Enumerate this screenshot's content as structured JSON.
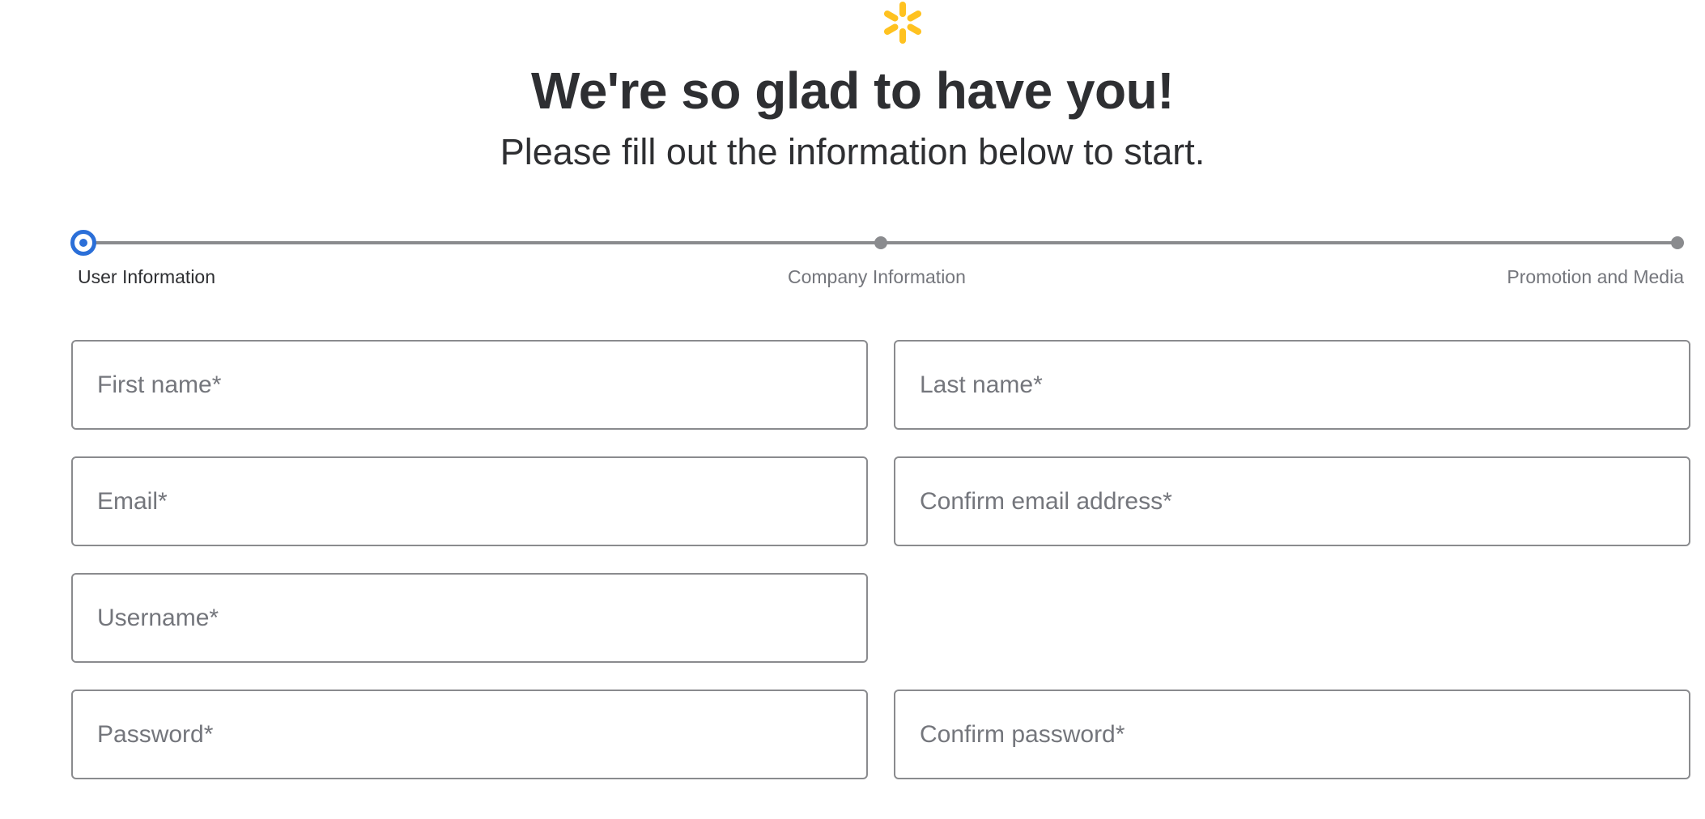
{
  "logo": {
    "icon": "spark-icon",
    "color": "#ffc220"
  },
  "header": {
    "title": "We're so glad to have you!",
    "subtitle": "Please fill out the information below to start."
  },
  "stepper": {
    "accent_color": "#2b6fd8",
    "steps": [
      {
        "label": "User Information",
        "state": "active"
      },
      {
        "label": "Company Information",
        "state": "pending"
      },
      {
        "label": "Promotion and Media",
        "state": "pending"
      }
    ]
  },
  "form": {
    "first_name": {
      "placeholder": "First name*",
      "value": ""
    },
    "last_name": {
      "placeholder": "Last name*",
      "value": ""
    },
    "email": {
      "placeholder": "Email*",
      "value": ""
    },
    "confirm_email": {
      "placeholder": "Confirm email address*",
      "value": ""
    },
    "username": {
      "placeholder": "Username*",
      "value": ""
    },
    "password": {
      "placeholder": "Password*",
      "value": ""
    },
    "confirm_password": {
      "placeholder": "Confirm password*",
      "value": ""
    }
  }
}
